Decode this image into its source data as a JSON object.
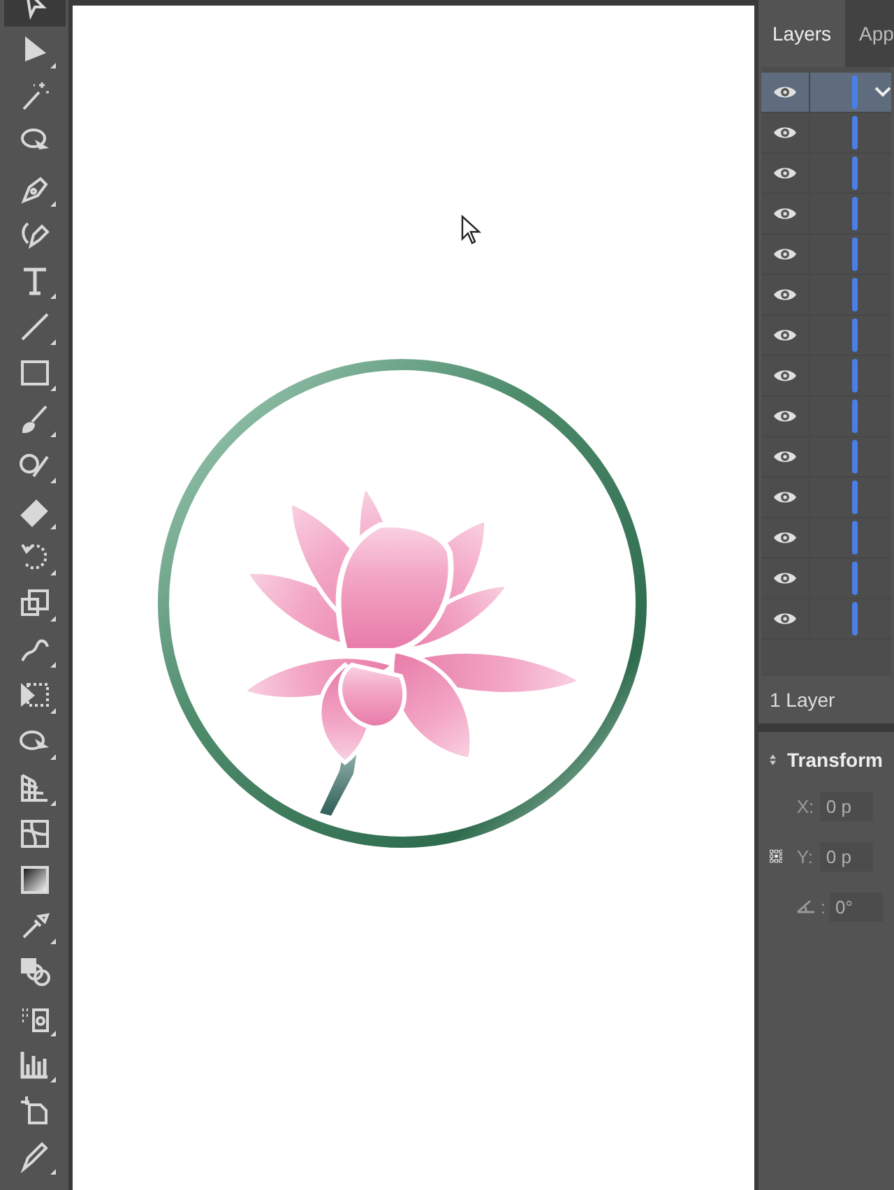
{
  "toolbar": {
    "tools": [
      {
        "kind": "selection",
        "selected": true,
        "flyout": false
      },
      {
        "kind": "direct",
        "selected": false,
        "flyout": true
      },
      {
        "kind": "wand",
        "selected": false,
        "flyout": false
      },
      {
        "kind": "lasso",
        "selected": false,
        "flyout": false
      },
      {
        "kind": "pen",
        "selected": false,
        "flyout": true
      },
      {
        "kind": "curvature",
        "selected": false,
        "flyout": false
      },
      {
        "kind": "type",
        "selected": false,
        "flyout": true
      },
      {
        "kind": "line",
        "selected": false,
        "flyout": true
      },
      {
        "kind": "rect",
        "selected": false,
        "flyout": true
      },
      {
        "kind": "brush",
        "selected": false,
        "flyout": true
      },
      {
        "kind": "shaper",
        "selected": false,
        "flyout": true
      },
      {
        "kind": "eraser",
        "selected": false,
        "flyout": true
      },
      {
        "kind": "rotate",
        "selected": false,
        "flyout": true
      },
      {
        "kind": "scale",
        "selected": false,
        "flyout": true
      },
      {
        "kind": "warp",
        "selected": false,
        "flyout": true
      },
      {
        "kind": "freetransform",
        "selected": false,
        "flyout": true
      },
      {
        "kind": "shapebuilder",
        "selected": false,
        "flyout": true
      },
      {
        "kind": "perspective",
        "selected": false,
        "flyout": true
      },
      {
        "kind": "mesh",
        "selected": false,
        "flyout": false
      },
      {
        "kind": "gradient",
        "selected": false,
        "flyout": false
      },
      {
        "kind": "eyedropper",
        "selected": false,
        "flyout": true
      },
      {
        "kind": "blend",
        "selected": false,
        "flyout": false
      },
      {
        "kind": "symbol",
        "selected": false,
        "flyout": true
      },
      {
        "kind": "graph",
        "selected": false,
        "flyout": true
      },
      {
        "kind": "artboard",
        "selected": false,
        "flyout": false
      },
      {
        "kind": "slice",
        "selected": false,
        "flyout": true
      }
    ]
  },
  "layers_panel": {
    "tabs": [
      {
        "label": "Layers",
        "selected": true
      },
      {
        "label": "App",
        "selected": false
      }
    ],
    "rows": [
      {
        "kind": "layer",
        "visible": true,
        "selected": true
      },
      {
        "kind": "item",
        "visible": true,
        "selected": false
      },
      {
        "kind": "item",
        "visible": true,
        "selected": false
      },
      {
        "kind": "item",
        "visible": true,
        "selected": false
      },
      {
        "kind": "item",
        "visible": true,
        "selected": false
      },
      {
        "kind": "item",
        "visible": true,
        "selected": false
      },
      {
        "kind": "item",
        "visible": true,
        "selected": false
      },
      {
        "kind": "item",
        "visible": true,
        "selected": false
      },
      {
        "kind": "item",
        "visible": true,
        "selected": false
      },
      {
        "kind": "item",
        "visible": true,
        "selected": false
      },
      {
        "kind": "item",
        "visible": true,
        "selected": false
      },
      {
        "kind": "item",
        "visible": true,
        "selected": false
      },
      {
        "kind": "item",
        "visible": true,
        "selected": false
      },
      {
        "kind": "item",
        "visible": true,
        "selected": false
      }
    ],
    "footer": "1 Layer"
  },
  "transform_panel": {
    "title": "Transform",
    "fields": [
      {
        "kind": "x",
        "label": "X:",
        "value": "0 p",
        "disabled": true
      },
      {
        "kind": "y",
        "label": "Y:",
        "value": "0 p",
        "disabled": true
      },
      {
        "kind": "angle",
        "label": ":",
        "value": "0°",
        "disabled": true
      }
    ]
  }
}
